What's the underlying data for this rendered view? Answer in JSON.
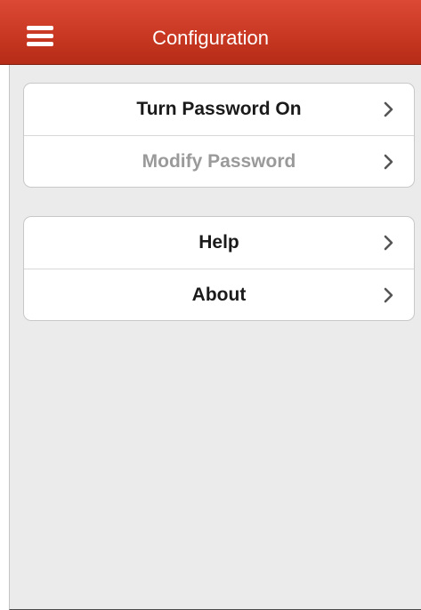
{
  "header": {
    "title": "Configuration",
    "menu_icon": "hamburger-menu-icon"
  },
  "colors": {
    "header_bg": "#c93822",
    "content_bg": "#ebebeb",
    "row_bg": "#ffffff",
    "text_primary": "#1a1a1a",
    "text_disabled": "#9a9a9a"
  },
  "sections": [
    {
      "items": [
        {
          "label": "Turn Password On",
          "enabled": true,
          "icon": "chevron-right-icon"
        },
        {
          "label": "Modify Password",
          "enabled": false,
          "icon": "chevron-right-icon"
        }
      ]
    },
    {
      "items": [
        {
          "label": "Help",
          "enabled": true,
          "icon": "chevron-right-icon"
        },
        {
          "label": "About",
          "enabled": true,
          "icon": "chevron-right-icon"
        }
      ]
    }
  ]
}
